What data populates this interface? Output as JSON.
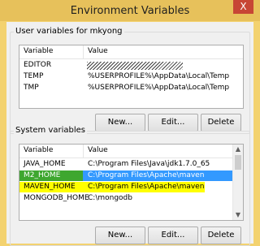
{
  "window": {
    "title": "Environment Variables",
    "close_label": "X"
  },
  "user_vars": {
    "group_label": "User variables for mkyong",
    "headers": [
      "Variable",
      "Value"
    ],
    "rows": [
      {
        "var": "EDITOR",
        "value": ""
      },
      {
        "var": "TEMP",
        "value": "%USERPROFILE%\\AppData\\Local\\Temp"
      },
      {
        "var": "TMP",
        "value": "%USERPROFILE%\\AppData\\Local\\Temp"
      }
    ],
    "buttons": {
      "new": "New...",
      "edit": "Edit...",
      "delete": "Delete"
    }
  },
  "system_vars": {
    "group_label": "System variables",
    "headers": [
      "Variable",
      "Value"
    ],
    "rows": [
      {
        "var": "JAVA_HOME",
        "value": "C:\\Program Files\\Java\\jdk1.7.0_65"
      },
      {
        "var": "M2_HOME",
        "value": "C:\\Program Files\\Apache\\maven"
      },
      {
        "var": "MAVEN_HOME",
        "value": "C:\\Program Files\\Apache\\maven"
      },
      {
        "var": "MONGODB_HOME",
        "value": "C:\\mongodb"
      }
    ],
    "buttons": {
      "new": "New...",
      "edit": "Edit...",
      "delete": "Delete"
    }
  },
  "colors": {
    "highlight_green": "#3ea72f",
    "highlight_yellow": "#ffff00",
    "selection_blue": "#3399ff"
  },
  "icons": {
    "scroll_up": "scroll-up-arrow-icon",
    "scroll_down": "scroll-down-arrow-icon"
  }
}
